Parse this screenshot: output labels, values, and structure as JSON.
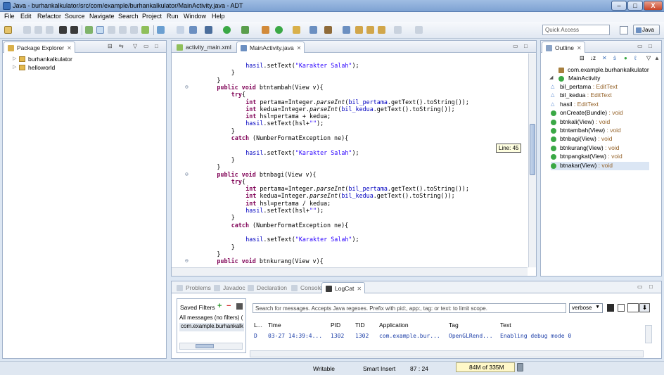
{
  "window": {
    "title": "Java - burhankalkulator/src/com/example/burhankalkulator/MainActivity.java - ADT",
    "minimize": "–",
    "maximize": "□",
    "close": "X"
  },
  "menu": [
    "File",
    "Edit",
    "Refactor",
    "Source",
    "Navigate",
    "Search",
    "Project",
    "Run",
    "Window",
    "Help"
  ],
  "toolbar": {
    "quick_access_placeholder": "Quick Access",
    "perspective_label": "Java"
  },
  "package_explorer": {
    "title": "Package Explorer",
    "items": [
      "burhankalkulator",
      "helloworld"
    ]
  },
  "editor": {
    "tabs": [
      {
        "label": "activity_main.xml",
        "active": false
      },
      {
        "label": "MainActivity.java",
        "active": true
      }
    ],
    "tooltip": "Line: 45",
    "lines": [
      {
        "indent": 12,
        "parts": [
          {
            "t": "hasil",
            "c": "fld"
          },
          {
            "t": ".setText("
          },
          {
            "t": "\"Karakter Salah\"",
            "c": "str"
          },
          {
            "t": ");"
          }
        ]
      },
      {
        "indent": 8,
        "parts": [
          {
            "t": "}"
          }
        ]
      },
      {
        "indent": 4,
        "parts": [
          {
            "t": "}"
          }
        ]
      },
      {
        "indent": 4,
        "marker": "⊖",
        "parts": [
          {
            "t": "public void",
            "c": "kw"
          },
          {
            "t": " btntambah(View v){"
          }
        ]
      },
      {
        "indent": 8,
        "parts": [
          {
            "t": "try",
            "c": "kw"
          },
          {
            "t": "{"
          }
        ]
      },
      {
        "indent": 12,
        "parts": [
          {
            "t": "int",
            "c": "kw"
          },
          {
            "t": " pertama=Integer."
          },
          {
            "t": "parseInt",
            "c": "it"
          },
          {
            "t": "("
          },
          {
            "t": "bil_pertama",
            "c": "fld"
          },
          {
            "t": ".getText().toString());"
          }
        ]
      },
      {
        "indent": 12,
        "parts": [
          {
            "t": "int",
            "c": "kw"
          },
          {
            "t": " kedua=Integer."
          },
          {
            "t": "parseInt",
            "c": "it"
          },
          {
            "t": "("
          },
          {
            "t": "bil_kedua",
            "c": "fld"
          },
          {
            "t": ".getText().toString());"
          }
        ]
      },
      {
        "indent": 12,
        "parts": [
          {
            "t": "int",
            "c": "kw"
          },
          {
            "t": " hsl=pertama + kedua;"
          }
        ]
      },
      {
        "indent": 12,
        "parts": [
          {
            "t": "hasil",
            "c": "fld"
          },
          {
            "t": ".setText(hsl+"
          },
          {
            "t": "\"\"",
            "c": "str"
          },
          {
            "t": ");"
          }
        ]
      },
      {
        "indent": 8,
        "parts": [
          {
            "t": "}"
          }
        ]
      },
      {
        "indent": 8,
        "parts": [
          {
            "t": "catch",
            "c": "kw"
          },
          {
            "t": " (NumberFormatException ne){"
          }
        ]
      },
      {
        "indent": 0,
        "parts": []
      },
      {
        "indent": 12,
        "parts": [
          {
            "t": "hasil",
            "c": "fld"
          },
          {
            "t": ".setText("
          },
          {
            "t": "\"Karakter Salah\"",
            "c": "str"
          },
          {
            "t": ");"
          }
        ]
      },
      {
        "indent": 8,
        "parts": [
          {
            "t": "}"
          }
        ]
      },
      {
        "indent": 4,
        "parts": [
          {
            "t": "}"
          }
        ]
      },
      {
        "indent": 4,
        "marker": "⊖",
        "parts": [
          {
            "t": "public void",
            "c": "kw"
          },
          {
            "t": " btnbagi(View v){"
          }
        ]
      },
      {
        "indent": 8,
        "parts": [
          {
            "t": "try",
            "c": "kw"
          },
          {
            "t": "{"
          }
        ]
      },
      {
        "indent": 12,
        "parts": [
          {
            "t": "int",
            "c": "kw"
          },
          {
            "t": " pertama=Integer."
          },
          {
            "t": "parseInt",
            "c": "it"
          },
          {
            "t": "("
          },
          {
            "t": "bil_pertama",
            "c": "fld"
          },
          {
            "t": ".getText().toString());"
          }
        ]
      },
      {
        "indent": 12,
        "parts": [
          {
            "t": "int",
            "c": "kw"
          },
          {
            "t": " kedua=Integer."
          },
          {
            "t": "parseInt",
            "c": "it"
          },
          {
            "t": "("
          },
          {
            "t": "bil_kedua",
            "c": "fld"
          },
          {
            "t": ".getText().toString());"
          }
        ]
      },
      {
        "indent": 12,
        "parts": [
          {
            "t": "int",
            "c": "kw"
          },
          {
            "t": " hsl=pertama / kedua;"
          }
        ]
      },
      {
        "indent": 12,
        "parts": [
          {
            "t": "hasil",
            "c": "fld"
          },
          {
            "t": ".setText(hsl+"
          },
          {
            "t": "\"\"",
            "c": "str"
          },
          {
            "t": ");"
          }
        ]
      },
      {
        "indent": 8,
        "parts": [
          {
            "t": "}"
          }
        ]
      },
      {
        "indent": 8,
        "parts": [
          {
            "t": "catch",
            "c": "kw"
          },
          {
            "t": " (NumberFormatException ne){"
          }
        ]
      },
      {
        "indent": 0,
        "parts": []
      },
      {
        "indent": 12,
        "parts": [
          {
            "t": "hasil",
            "c": "fld"
          },
          {
            "t": ".setText("
          },
          {
            "t": "\"Karakter Salah\"",
            "c": "str"
          },
          {
            "t": ");"
          }
        ]
      },
      {
        "indent": 8,
        "parts": [
          {
            "t": "}"
          }
        ]
      },
      {
        "indent": 4,
        "parts": [
          {
            "t": "}"
          }
        ]
      },
      {
        "indent": 4,
        "marker": "⊖",
        "parts": [
          {
            "t": "public void",
            "c": "kw"
          },
          {
            "t": " btnkurang(View v){"
          }
        ]
      }
    ]
  },
  "outline": {
    "title": "Outline",
    "package": "com.example.burhankalkulator",
    "class": "MainActivity",
    "members": [
      {
        "name": "bil_pertama",
        "type": " : EditText",
        "kind": "field"
      },
      {
        "name": "bil_kedua",
        "type": " : EditText",
        "kind": "field"
      },
      {
        "name": "hasil",
        "type": " : EditText",
        "kind": "field"
      },
      {
        "name": "onCreate(Bundle)",
        "type": " : void",
        "kind": "method"
      },
      {
        "name": "btnkali(View)",
        "type": " : void",
        "kind": "method"
      },
      {
        "name": "btntambah(View)",
        "type": " : void",
        "kind": "method"
      },
      {
        "name": "btnbagi(View)",
        "type": " : void",
        "kind": "method"
      },
      {
        "name": "btnkurang(View)",
        "type": " : void",
        "kind": "method"
      },
      {
        "name": "btnpangkat(View)",
        "type": " : void",
        "kind": "method"
      },
      {
        "name": "btnakar(View)",
        "type": " : void",
        "kind": "method",
        "selected": true
      }
    ]
  },
  "bottom_panel": {
    "tabs": [
      "Problems",
      "Javadoc",
      "Declaration",
      "Console",
      "LogCat"
    ],
    "active_tab": "LogCat",
    "saved_filters_label": "Saved Filters",
    "filters": [
      "All messages (no filters) (",
      "com.example.burhankalk"
    ],
    "search_placeholder": "Search for messages. Accepts Java regexes. Prefix with pid:, app:, tag: or text: to limit scope.",
    "level": "verbose",
    "columns": [
      "L...",
      "Time",
      "PID",
      "TID",
      "Application",
      "Tag",
      "Text"
    ],
    "rows": [
      {
        "level": "D",
        "time": "03-27 14:39:4...",
        "pid": "1302",
        "tid": "1302",
        "app": "com.example.bur...",
        "tag": "OpenGLRend...",
        "text": "Enabling debug mode 0"
      }
    ]
  },
  "status": {
    "writable": "Writable",
    "insert_mode": "Smart Insert",
    "position": "87 : 24",
    "heap": "84M of 335M"
  },
  "colors": {
    "keyword": "#7f0055",
    "string": "#2a00ff",
    "field": "#0000c0",
    "method_public": "#3aa845",
    "field_icon": "#4a7fcf"
  }
}
